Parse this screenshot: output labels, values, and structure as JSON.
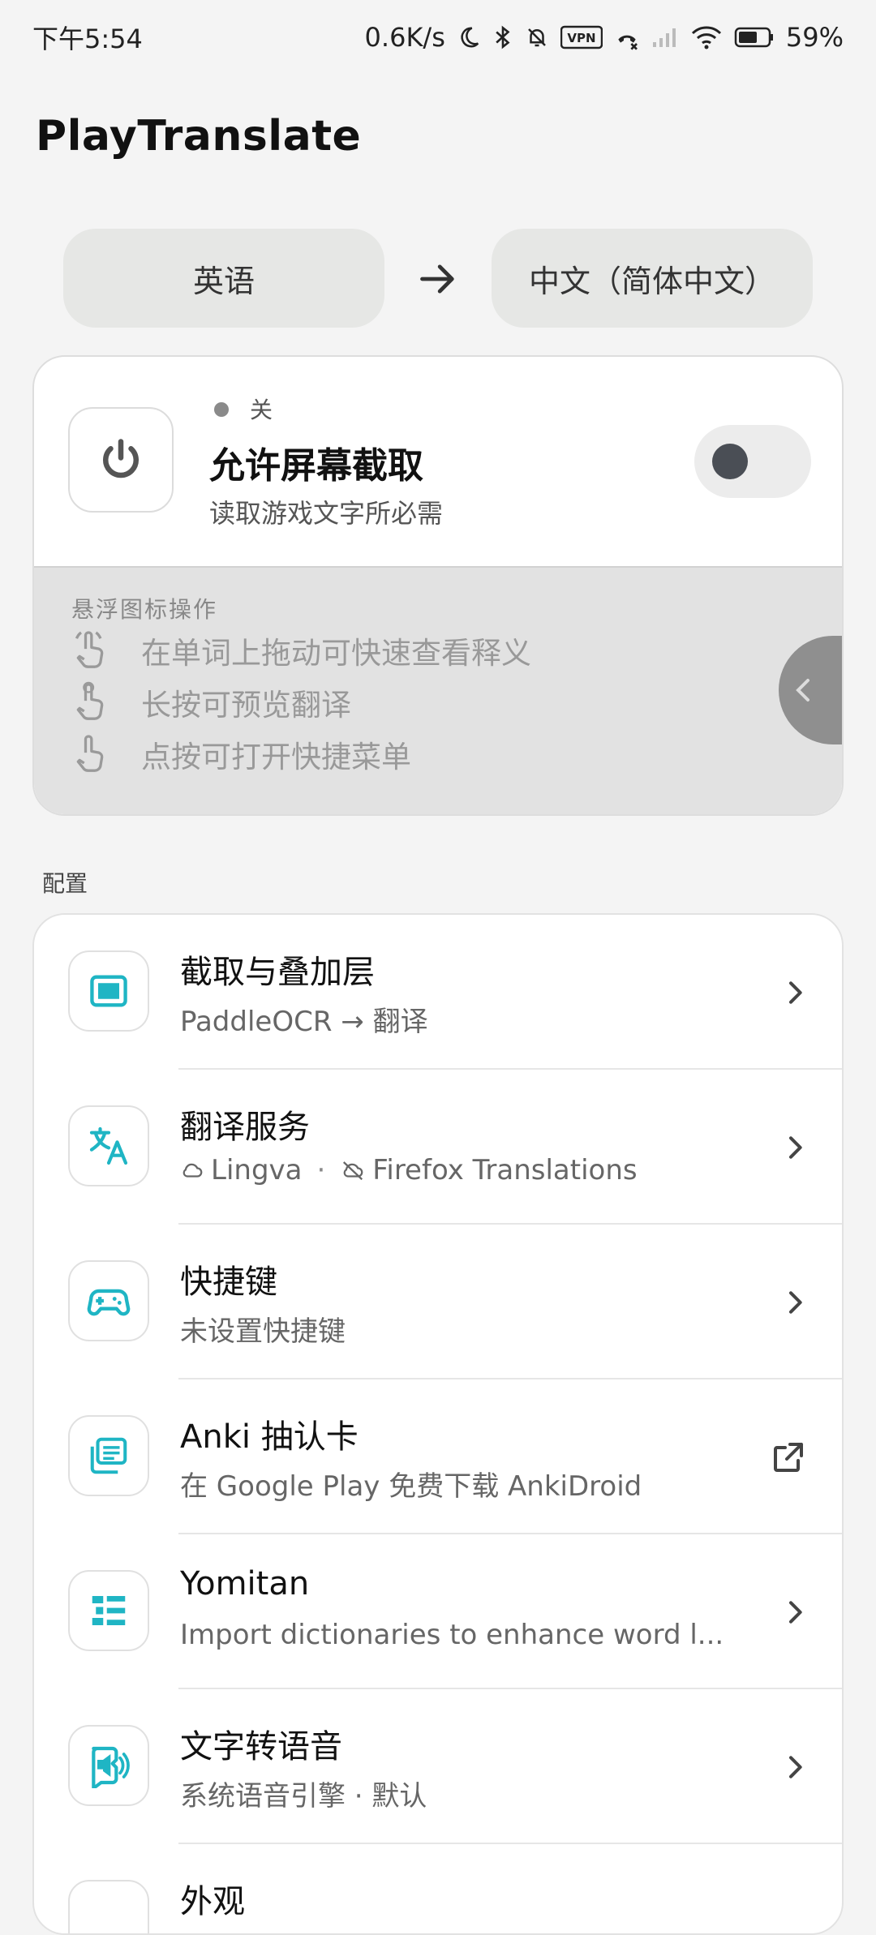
{
  "status_bar": {
    "time": "下午5:54",
    "net_speed": "0.6K/s",
    "vpn": "VPN",
    "battery": "59%"
  },
  "app": {
    "title": "PlayTranslate"
  },
  "languages": {
    "source": "英语",
    "target": "中文（简体中文）"
  },
  "capture": {
    "state": "关",
    "title": "允许屏幕截取",
    "subtitle": "读取游戏文字所必需",
    "enabled": false,
    "hint_heading": "悬浮图标操作",
    "hints": [
      {
        "icon": "drag-gesture-icon",
        "text": "在单词上拖动可快速查看释义"
      },
      {
        "icon": "long-press-gesture-icon",
        "text": "长按可预览翻译"
      },
      {
        "icon": "tap-gesture-icon",
        "text": "点按可打开快捷菜单"
      }
    ]
  },
  "config": {
    "section_label": "配置",
    "items": [
      {
        "icon": "screen-capture-icon",
        "title": "截取与叠加层",
        "subtitle": "PaddleOCR → 翻译",
        "action": "chevron"
      },
      {
        "icon": "translate-icon",
        "title": "翻译服务",
        "subtitle_parts": [
          "Lingva",
          "·",
          "Firefox Translations"
        ],
        "action": "chevron"
      },
      {
        "icon": "gamepad-icon",
        "title": "快捷键",
        "subtitle": "未设置快捷键",
        "action": "chevron"
      },
      {
        "icon": "flashcards-icon",
        "title": "Anki 抽认卡",
        "subtitle": "在 Google Play 免费下载 AnkiDroid",
        "action": "external"
      },
      {
        "icon": "dictionary-icon",
        "title": "Yomitan",
        "subtitle": "Import dictionaries to enhance word l...",
        "action": "chevron"
      },
      {
        "icon": "text-to-speech-icon",
        "title": "文字转语音",
        "subtitle": "系统语音引擎 · 默认",
        "action": "chevron"
      },
      {
        "icon": "appearance-icon",
        "title": "外观",
        "subtitle": "",
        "action": "chevron"
      }
    ]
  },
  "colors": {
    "accent": "#1fb5c4",
    "toggle_off": "#4a4e55",
    "background": "#f4f4f4"
  }
}
